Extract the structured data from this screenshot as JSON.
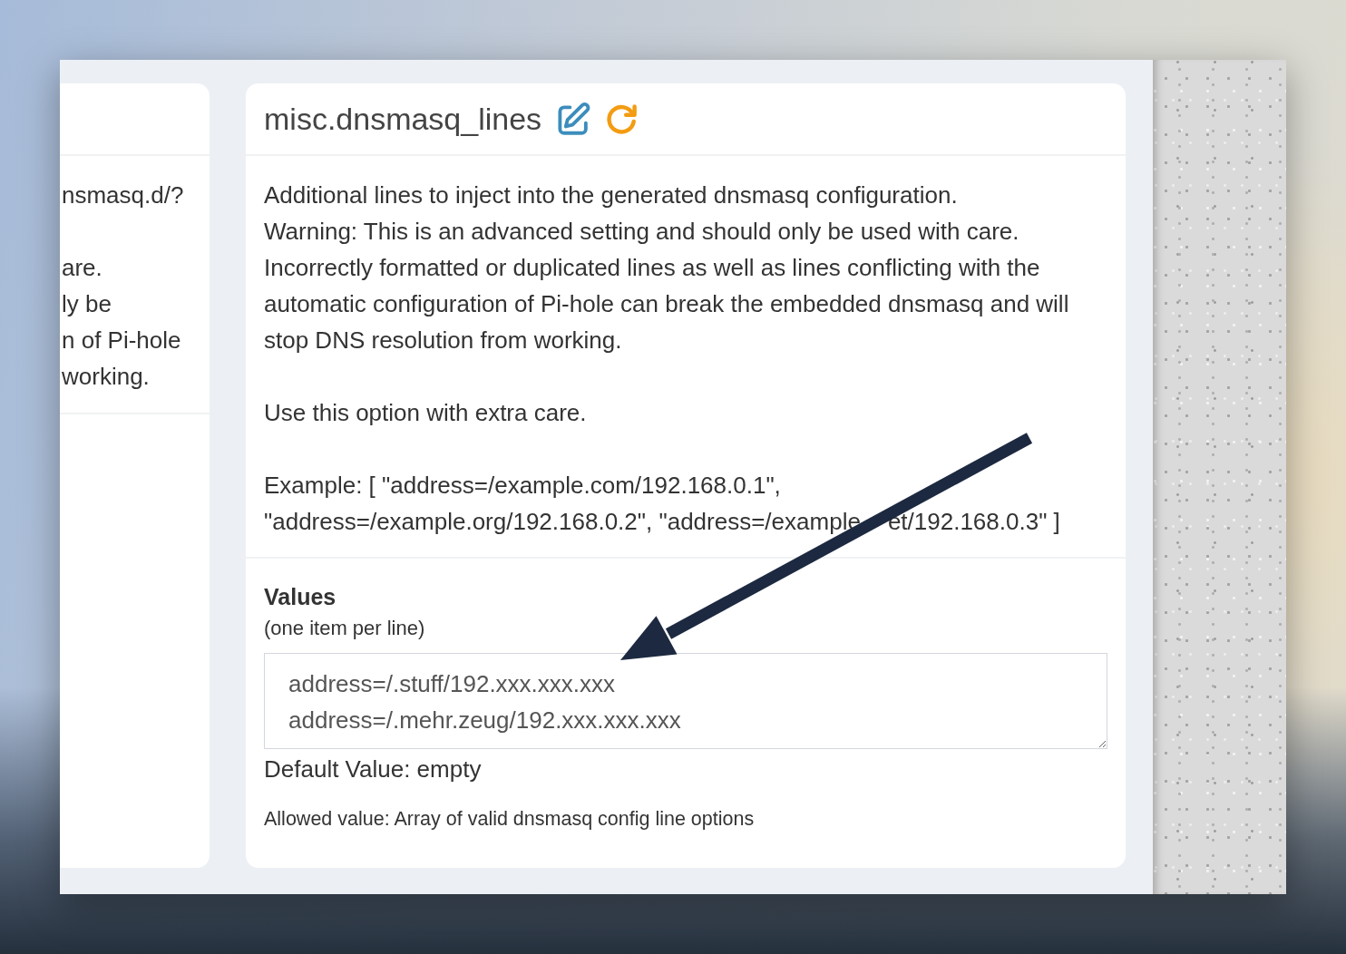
{
  "left_card": {
    "paragraphs": [
      "nsmasq.d/?",
      "are.\nly be\nn of Pi-hole\nworking."
    ]
  },
  "setting": {
    "title": "misc.dnsmasq_lines",
    "description": [
      "Additional lines to inject into the generated dnsmasq configuration.\nWarning: This is an advanced setting and should only be used with care.\nIncorrectly formatted or duplicated lines as well as lines conflicting with the automatic configuration of Pi-hole can break the embedded dnsmasq and will stop DNS resolution from working.",
      "Use this option with extra care."
    ],
    "example": {
      "text": "Example: [ \"address=/example.com/192.168.0.1\", \"address=/example.org/192.168.0.2\", \"address=/example",
      "after_arrow": "et/192.168.0.3\" ]"
    },
    "values": {
      "label": "Values",
      "note": "(one item per line)",
      "value": "address=/.stuff/192.xxx.xxx.xxx\naddress=/.mehr.zeug/192.xxx.xxx.xxx",
      "default_value": "Default Value: empty",
      "allowed": "Allowed value: Array of valid dnsmasq config line options"
    }
  }
}
